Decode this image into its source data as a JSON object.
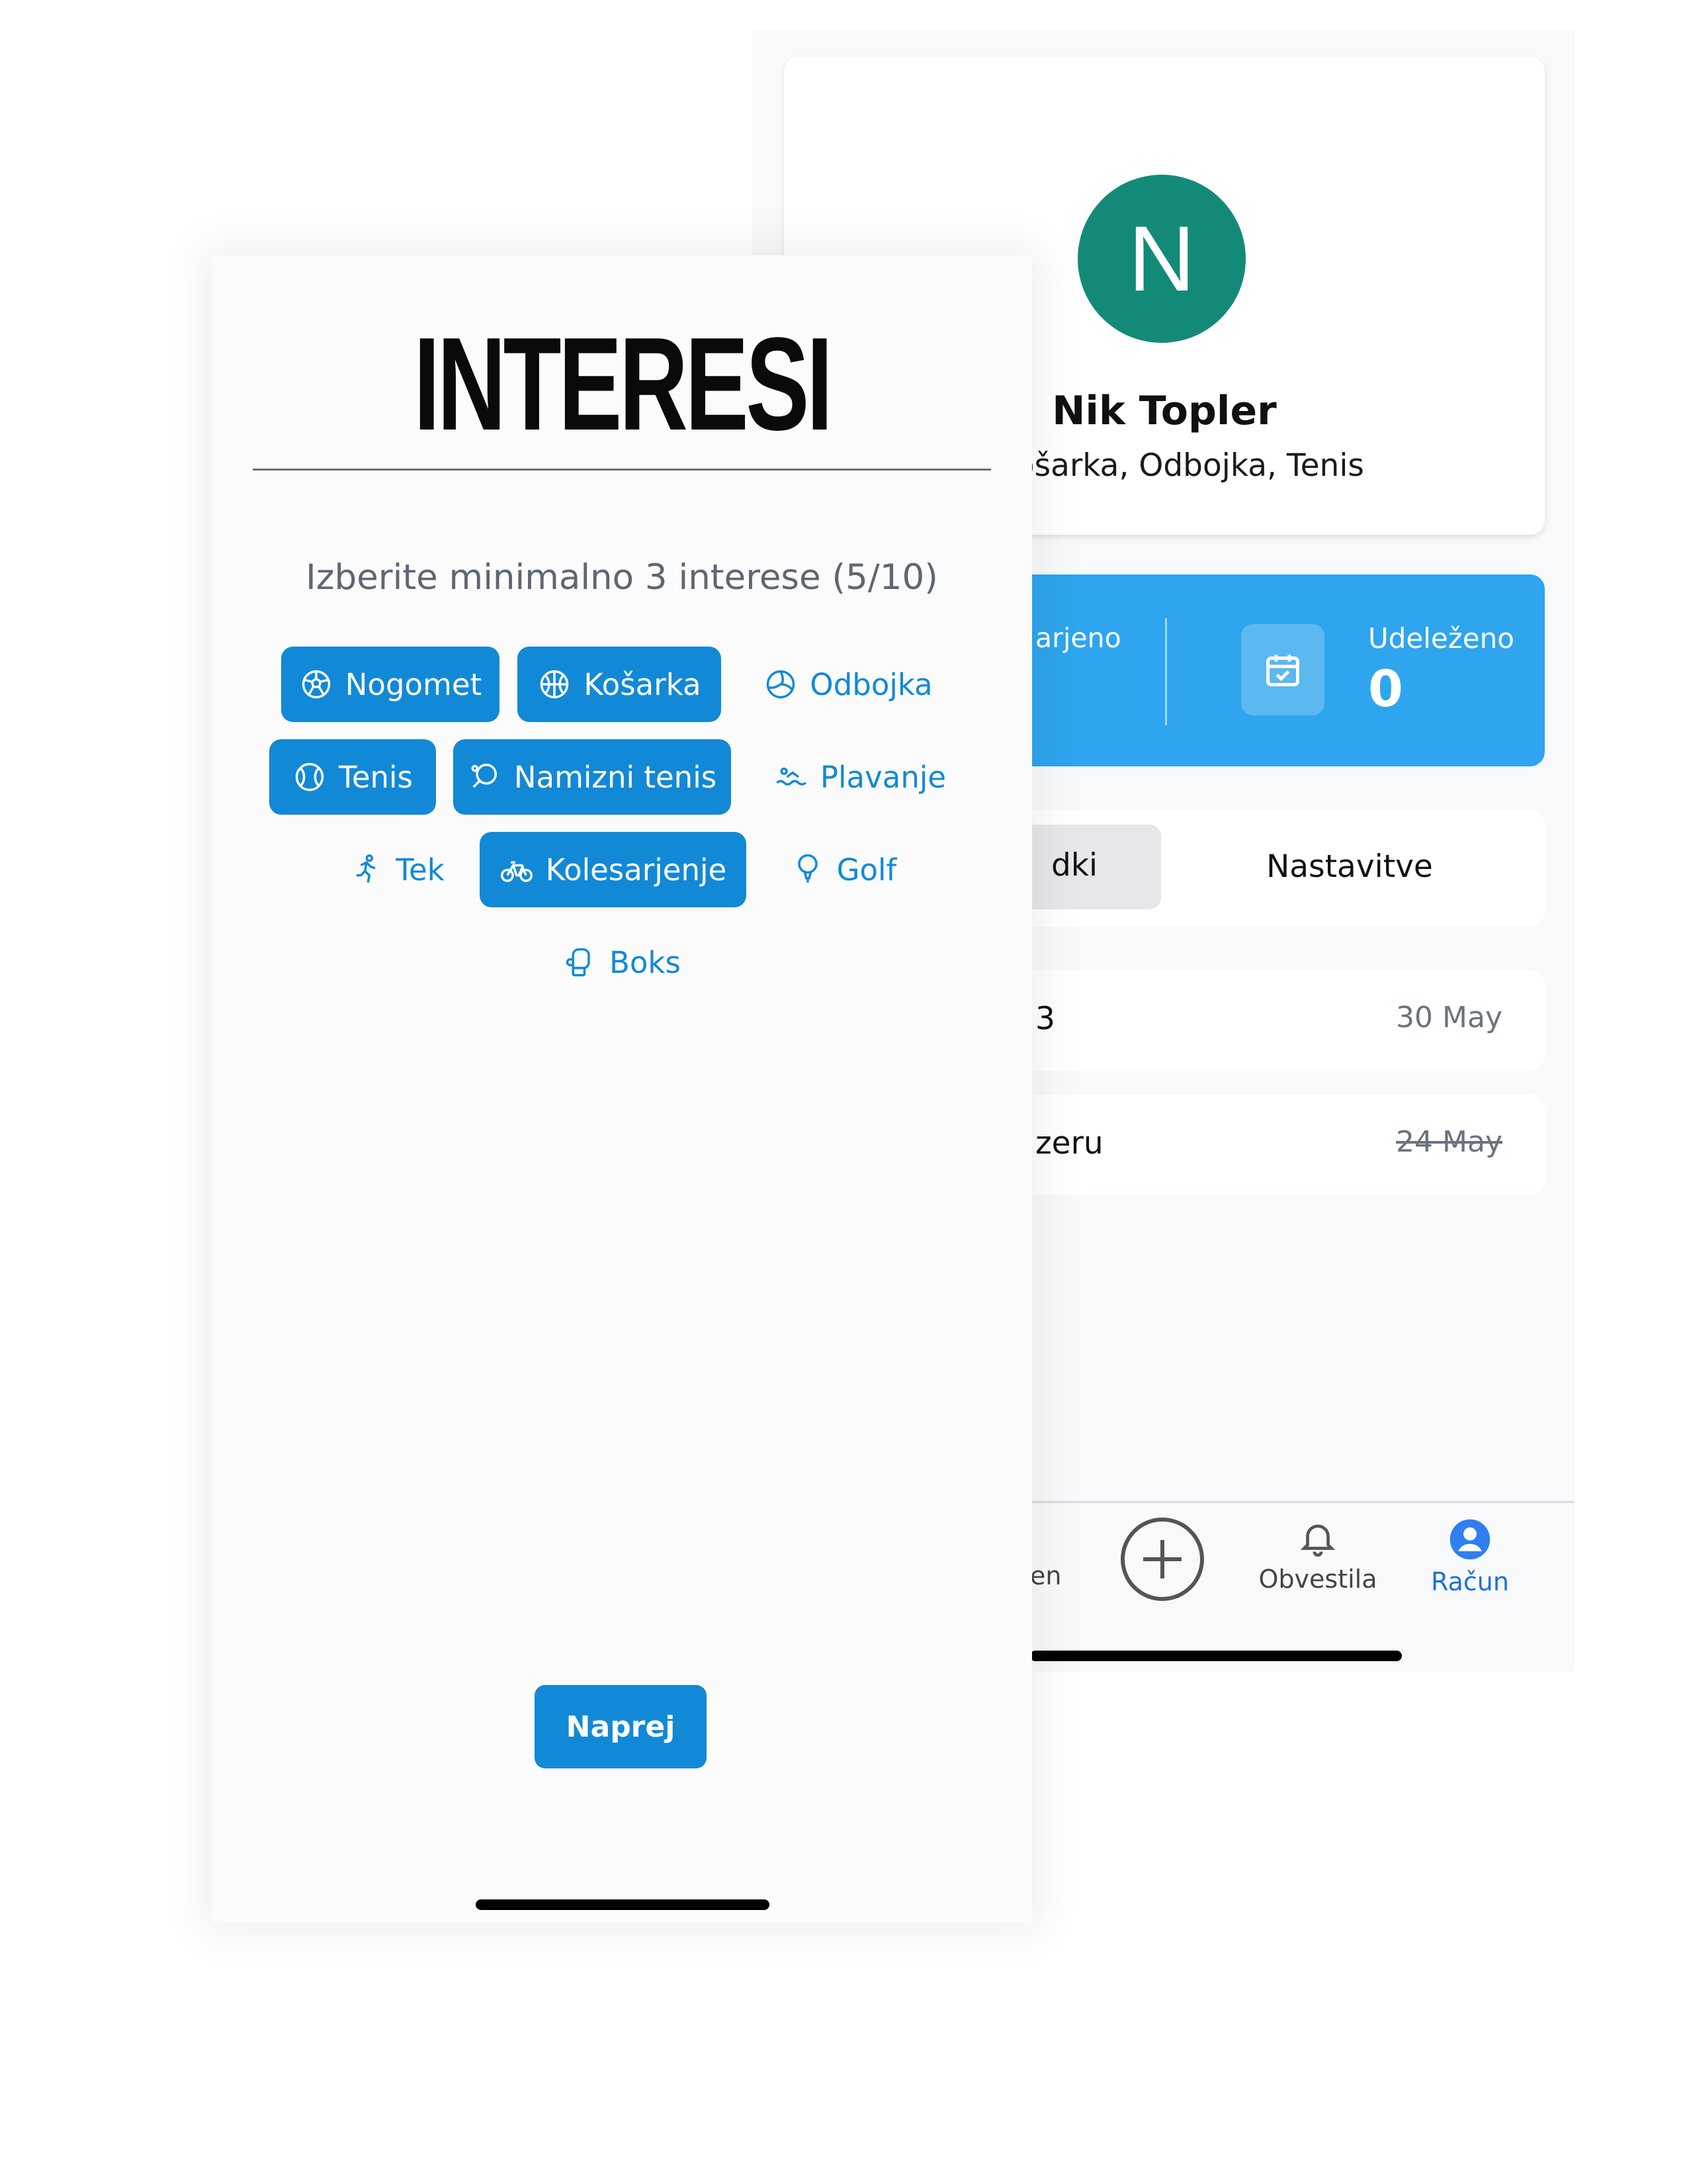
{
  "profile": {
    "avatar_letter": "N",
    "name": "Nik Topler",
    "interests": "t, Košarka, Odbojka, Tenis",
    "stats": {
      "left_label": "arjeno",
      "right_label": "Udeleženo",
      "right_value": "0"
    },
    "tabs": [
      "dki",
      "Nastavitve"
    ],
    "events": [
      {
        "name": "3",
        "date": "30 May"
      },
      {
        "name": "zeru",
        "date": "24 May"
      }
    ],
    "nav": {
      "home_label": "en",
      "notify_label": "Obvestila",
      "account_label": "Račun"
    }
  },
  "interests": {
    "title": "INTERESI",
    "instruction": "Izberite minimalno 3 interese (5/10)",
    "chips": [
      {
        "label": "Nogomet",
        "selected": true,
        "icon": "soccer-ball-icon"
      },
      {
        "label": "Košarka",
        "selected": true,
        "icon": "basketball-icon"
      },
      {
        "label": "Odbojka",
        "selected": false,
        "icon": "volleyball-icon"
      },
      {
        "label": "Tenis",
        "selected": true,
        "icon": "tennis-ball-icon"
      },
      {
        "label": "Namizni tenis",
        "selected": true,
        "icon": "ping-pong-icon"
      },
      {
        "label": "Plavanje",
        "selected": false,
        "icon": "swimming-icon"
      },
      {
        "label": "Tek",
        "selected": false,
        "icon": "running-icon"
      },
      {
        "label": "Kolesarjenje",
        "selected": true,
        "icon": "bicycle-icon"
      },
      {
        "label": "Golf",
        "selected": false,
        "icon": "golf-icon"
      },
      {
        "label": "Boks",
        "selected": false,
        "icon": "boxing-glove-icon"
      }
    ],
    "next_label": "Naprej"
  },
  "colors": {
    "accent": "#1289d6",
    "stats_bg": "#2ea5ee",
    "avatar_bg": "#138a78",
    "nav_active": "#1f6fd9"
  }
}
